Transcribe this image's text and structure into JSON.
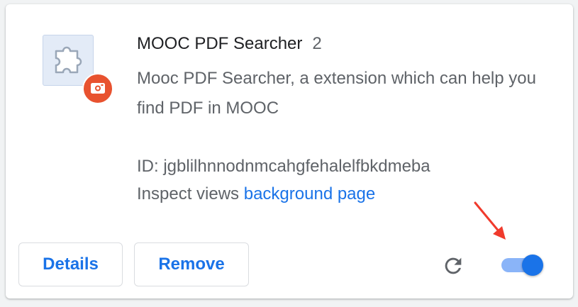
{
  "extension": {
    "name": "MOOC PDF Searcher",
    "version": "2",
    "description": "Mooc PDF Searcher, a extension which can help you find PDF in MOOC",
    "id_label": "ID: ",
    "id_value": "jgblilhnnodnmcahgfehalelfbkdmeba",
    "inspect_label": "Inspect views ",
    "inspect_link": "background page",
    "icon": "puzzle-piece-icon",
    "badge_icon": "camera-badge-icon",
    "badge_color": "#e8522f"
  },
  "actions": {
    "details_label": "Details",
    "remove_label": "Remove",
    "reload_icon": "reload-icon",
    "enabled": true
  },
  "colors": {
    "accent": "#1a73e8",
    "annotation_arrow": "#f03a2c"
  }
}
